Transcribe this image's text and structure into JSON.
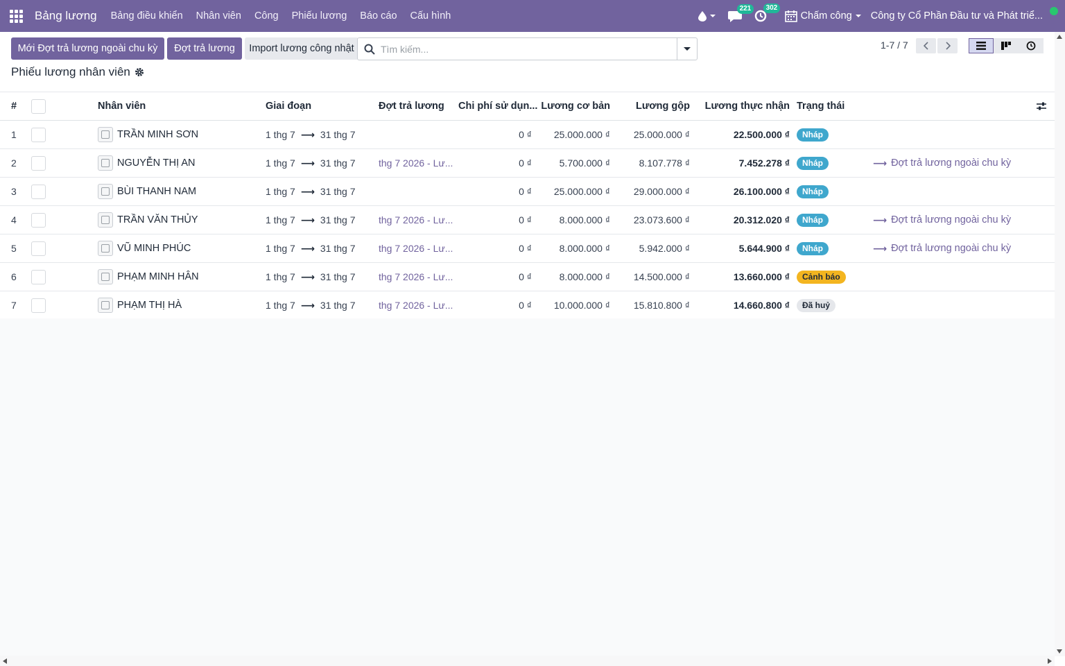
{
  "navbar": {
    "app_title": "Bảng lương",
    "menu": [
      "Bảng điều khiển",
      "Nhân viên",
      "Công",
      "Phiếu lương",
      "Báo cáo",
      "Cấu hình"
    ],
    "messages_count": "221",
    "activities_count": "302",
    "attendance_label": "Chấm công",
    "company": "Công ty Cổ Phần Đầu tư và Phát triể..."
  },
  "control_panel": {
    "btn_new_offcycle": "Mới Đợt trả lương ngoài chu kỳ",
    "btn_payrun": "Đợt trả lương",
    "btn_import": "Import lương công nhật",
    "search_placeholder": "Tìm kiếm...",
    "page_title": "Phiếu lương nhân viên",
    "pager": "1-7 / 7"
  },
  "table": {
    "headers": {
      "index": "#",
      "employee": "Nhân viên",
      "period": "Giai đoạn",
      "payrun": "Đợt trả lương",
      "expense": "Chi phí sử dụn...",
      "basic": "Lương cơ bản",
      "gross": "Lương gộp",
      "net": "Lương thực nhận",
      "status": "Trạng thái"
    },
    "rows": [
      {
        "idx": "1",
        "name": "TRẦN MINH SƠN",
        "from": "1 thg 7",
        "to": "31 thg 7",
        "payrun": "",
        "expense": "0 ₫",
        "basic": "25.000.000 ₫",
        "gross": "25.000.000 ₫",
        "net": "22.500.000 ₫",
        "status": "Nháp",
        "action": ""
      },
      {
        "idx": "2",
        "name": "NGUYỄN THỊ AN",
        "from": "1 thg 7",
        "to": "31 thg 7",
        "payrun": "thg 7 2026 - Lư...",
        "expense": "0 ₫",
        "basic": "5.700.000 ₫",
        "gross": "8.107.778 ₫",
        "net": "7.452.278 ₫",
        "status": "Nháp",
        "action": "Đợt trả lương ngoài chu kỳ"
      },
      {
        "idx": "3",
        "name": "BÙI THANH NAM",
        "from": "1 thg 7",
        "to": "31 thg 7",
        "payrun": "",
        "expense": "0 ₫",
        "basic": "25.000.000 ₫",
        "gross": "29.000.000 ₫",
        "net": "26.100.000 ₫",
        "status": "Nháp",
        "action": ""
      },
      {
        "idx": "4",
        "name": "TRẦN VĂN THỦY",
        "from": "1 thg 7",
        "to": "31 thg 7",
        "payrun": "thg 7 2026 - Lư...",
        "expense": "0 ₫",
        "basic": "8.000.000 ₫",
        "gross": "23.073.600 ₫",
        "net": "20.312.020 ₫",
        "status": "Nháp",
        "action": "Đợt trả lương ngoài chu kỳ"
      },
      {
        "idx": "5",
        "name": "VŨ MINH PHÚC",
        "from": "1 thg 7",
        "to": "31 thg 7",
        "payrun": "thg 7 2026 - Lư...",
        "expense": "0 ₫",
        "basic": "8.000.000 ₫",
        "gross": "5.942.000 ₫",
        "net": "5.644.900 ₫",
        "status": "Nháp",
        "action": "Đợt trả lương ngoài chu kỳ"
      },
      {
        "idx": "6",
        "name": "PHẠM MINH HÂN",
        "from": "1 thg 7",
        "to": "31 thg 7",
        "payrun": "thg 7 2026 - Lư...",
        "expense": "0 ₫",
        "basic": "8.000.000 ₫",
        "gross": "14.500.000 ₫",
        "net": "13.660.000 ₫",
        "status": "Cảnh báo",
        "action": ""
      },
      {
        "idx": "7",
        "name": "PHẠM THỊ HÀ",
        "from": "1 thg 7",
        "to": "31 thg 7",
        "payrun": "thg 7 2026 - Lư...",
        "expense": "0 ₫",
        "basic": "10.000.000 ₫",
        "gross": "15.810.800 ₫",
        "net": "14.660.800 ₫",
        "status": "Đã huỷ",
        "action": ""
      }
    ]
  },
  "colors": {
    "brand": "#71639e",
    "tag_draft": "#3fa7cd",
    "tag_warning": "#f3b520",
    "tag_cancel": "#e5e7eb"
  }
}
